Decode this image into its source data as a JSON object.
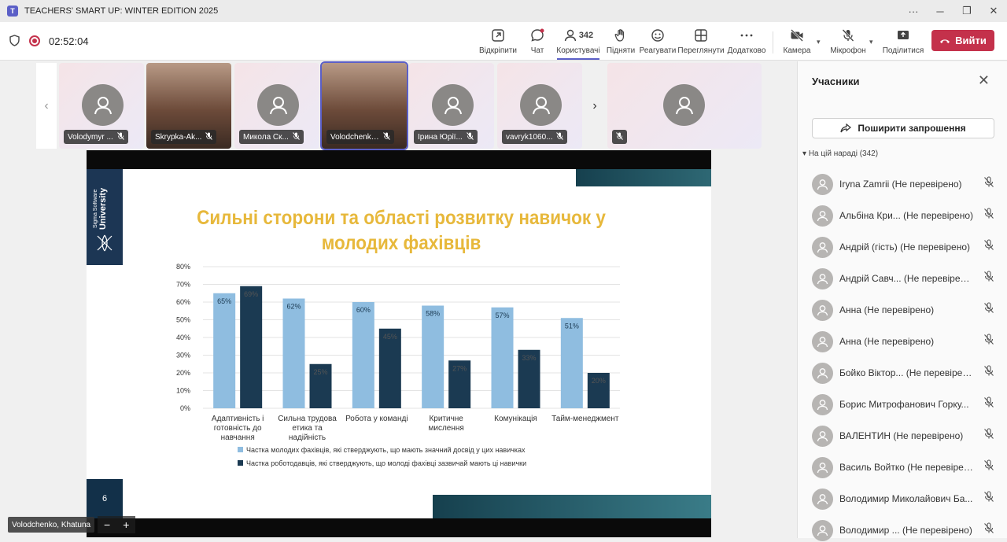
{
  "window": {
    "title": "TEACHERS' SMART UP: WINTER EDITION 2025",
    "logo": "T"
  },
  "meeting": {
    "timer": "02:52:04"
  },
  "toolbar": {
    "open": "Відкріпити",
    "chat": "Чат",
    "people": "Користувачі",
    "people_count": "342",
    "raise": "Підняти",
    "react": "Реагувати",
    "view": "Переглянути",
    "more": "Додатково",
    "camera": "Камера",
    "mic": "Мікрофон",
    "share": "Поділитися",
    "leave": "Вийти"
  },
  "gallery": [
    {
      "name": "Volodymyr ...",
      "video": false
    },
    {
      "name": "Skrypka-Ak...",
      "video": true
    },
    {
      "name": "Микола Ск...",
      "video": false
    },
    {
      "name": "Volodchenko, K...",
      "video": true,
      "speaking": true
    },
    {
      "name": "Ірина Юрії...",
      "video": false
    },
    {
      "name": "vavryk1060...",
      "video": false
    },
    {
      "name": "",
      "video": false
    }
  ],
  "presenter": {
    "name": "Volodchenko, Khatuna",
    "zoom_out": "−",
    "zoom_in": "+"
  },
  "slide": {
    "brand_top": "Sigma Software",
    "brand_bottom": "University",
    "title": "Сильні сторони та області розвитку навичок у молодих фахівців",
    "page": "6"
  },
  "chart_data": {
    "type": "bar",
    "categories": [
      "Адаптивність і готовність до навчання",
      "Сильна трудова етика та надійність",
      "Робота у команді",
      "Критичне мислення",
      "Комунікація",
      "Тайм-менеджмент"
    ],
    "category_lines": [
      [
        "Адаптивність і",
        "готовність до",
        "навчання"
      ],
      [
        "Сильна трудова",
        "етика та",
        "надійність"
      ],
      [
        "Робота у команді"
      ],
      [
        "Критичне",
        "мислення"
      ],
      [
        "Комунікація"
      ],
      [
        "Тайм-менеджмент"
      ]
    ],
    "series": [
      {
        "name": "Частка молодих фахівців, які стверджують, що мають значний досвід у цих навичках",
        "color": "#8fbde0",
        "values": [
          65,
          62,
          60,
          58,
          57,
          51
        ]
      },
      {
        "name": "Частка роботодавців, які стверджують, що молоді фахівці зазвичай мають ці навички",
        "color": "#1b3a52",
        "values": [
          69,
          25,
          45,
          27,
          33,
          20
        ]
      }
    ],
    "value_labels": [
      [
        "65%",
        "62%",
        "60%",
        "58%",
        "57%",
        "51%"
      ],
      [
        "69%",
        "25%",
        "45%",
        "27%",
        "33%",
        "20%"
      ]
    ],
    "ylim": [
      0,
      80
    ],
    "yticks": [
      "0%",
      "10%",
      "20%",
      "30%",
      "40%",
      "50%",
      "60%",
      "70%",
      "80%"
    ],
    "grid": true,
    "legend_position": "bottom"
  },
  "panel": {
    "title": "Учасники",
    "invite": "Поширити запрошення",
    "section": "На цій нараді (342)",
    "participants": [
      "Iryna Zamrii (Не перевірено)",
      "Альбіна Кри...  (Не перевірено)",
      "Андрій (гість) (Не перевірено)",
      "Андрій Савч...  (Не перевірено)",
      "Анна (Не перевірено)",
      "Анна (Не перевірено)",
      "Бойко Віктор... (Не перевірено)",
      "Борис Митрофанович Горку...",
      "ВАЛЕНТИН (Не перевірено)",
      "Василь Войтко (Не перевірен...",
      "Володимир Миколайович Ба...",
      "Володимир ...  (Не перевірено)"
    ]
  },
  "colors": {
    "accent": "#5b5fc7",
    "leave": "#c4314b",
    "title_gold": "#e7b83b"
  }
}
